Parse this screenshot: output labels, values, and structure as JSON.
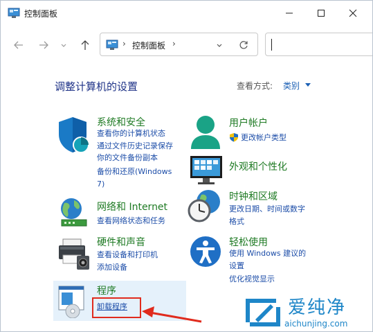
{
  "window": {
    "title": "控制面板",
    "controls": {
      "minimize": "minimize-icon",
      "maximize": "maximize-icon",
      "close": "close-icon"
    }
  },
  "address_bar": {
    "separator": "›",
    "path": "控制面板",
    "search_placeholder": ""
  },
  "content": {
    "heading": "调整计算机的设置",
    "view_by_label": "查看方式:",
    "view_by_value": "类别"
  },
  "categories": [
    {
      "title": "系统和安全",
      "links": [
        "查看你的计算机状态",
        "通过文件历史记录保存",
        "你的文件备份副本",
        "备份和还原(Windows",
        "7)"
      ]
    },
    {
      "title": "网络和 Internet",
      "links": [
        "查看网络状态和任务"
      ]
    },
    {
      "title": "硬件和声音",
      "links": [
        "查看设备和打印机",
        "添加设备"
      ]
    },
    {
      "title": "程序",
      "links": [
        "卸载程序"
      ]
    },
    {
      "title": "用户帐户",
      "links": [
        "更改帐户类型"
      ]
    },
    {
      "title": "外观和个性化",
      "links": []
    },
    {
      "title": "时钟和区域",
      "links": [
        "更改日期、时间或数字",
        "格式"
      ]
    },
    {
      "title": "轻松使用",
      "links": [
        "使用 Windows 建议的",
        "设置",
        "优化视觉显示"
      ]
    }
  ],
  "watermark": {
    "brand": "爱纯净",
    "url": "aichunjing.com"
  },
  "colors": {
    "category_title": "#1e7a23",
    "link": "#1c4da8",
    "heading": "#1e3287",
    "highlight": "#e02b1d",
    "watermark": "#1e86c8"
  }
}
